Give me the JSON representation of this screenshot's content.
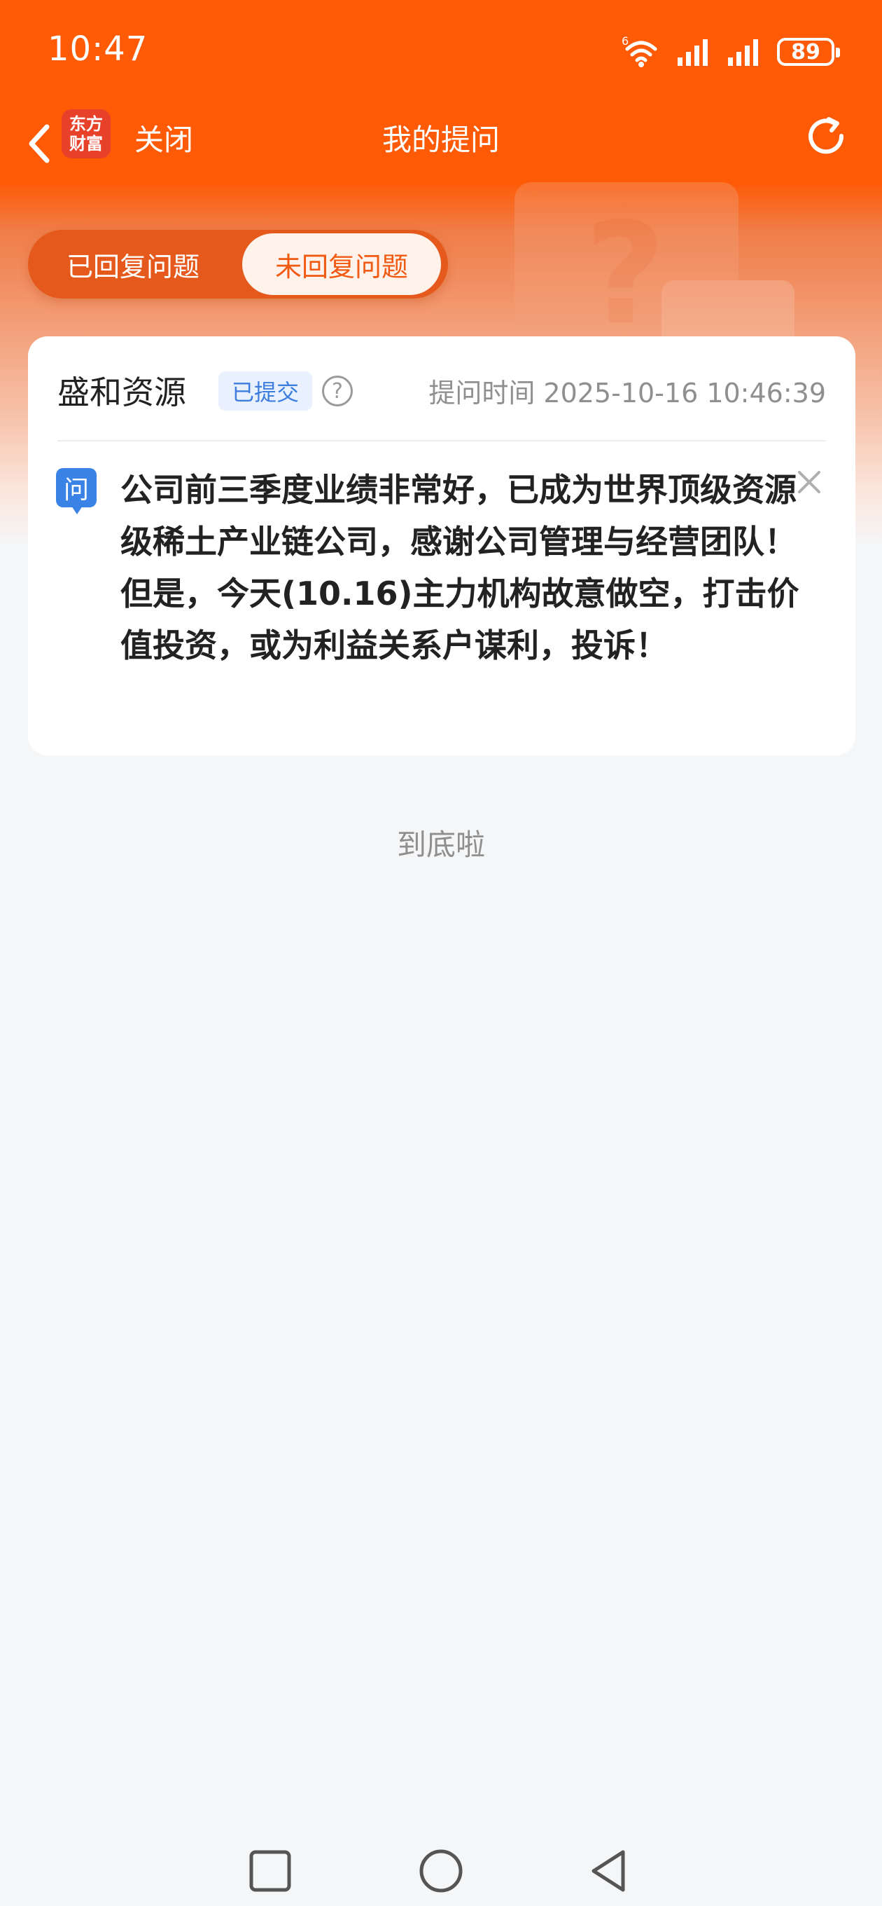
{
  "status_bar": {
    "time": "10:47",
    "battery": "89",
    "network_label": "6"
  },
  "nav": {
    "logo_text": "东方财富",
    "close_label": "关闭",
    "title": "我的提问"
  },
  "tabs": [
    {
      "label": "已回复问题",
      "selected": false
    },
    {
      "label": "未回复问题",
      "selected": true
    }
  ],
  "question_card": {
    "company": "盛和资源",
    "status_badge": "已提交",
    "help_glyph": "?",
    "ask_time_label": "提问时间",
    "ask_time": "2025-10-16 10:46:39",
    "question_icon": "问",
    "question_text": "公司前三季度业绩非常好，已成为世界顶级资源级稀土产业链公司，感谢公司管理与经营团队！但是，今天(10.16)主力机构故意做空，打击价值投资，或为利益关系户谋利，投诉！"
  },
  "end_text": "到底啦",
  "colors": {
    "brand": "#ff5a06",
    "tab_active_text": "#f15a12",
    "badge_blue": "#3e7de0",
    "question_icon_bg": "#3b82e6"
  },
  "icons": [
    "back-arrow-icon",
    "refresh-icon",
    "wifi-icon",
    "signal-icon",
    "battery-icon",
    "help-icon",
    "close-icon",
    "square-nav-icon",
    "circle-nav-icon",
    "triangle-nav-icon"
  ]
}
